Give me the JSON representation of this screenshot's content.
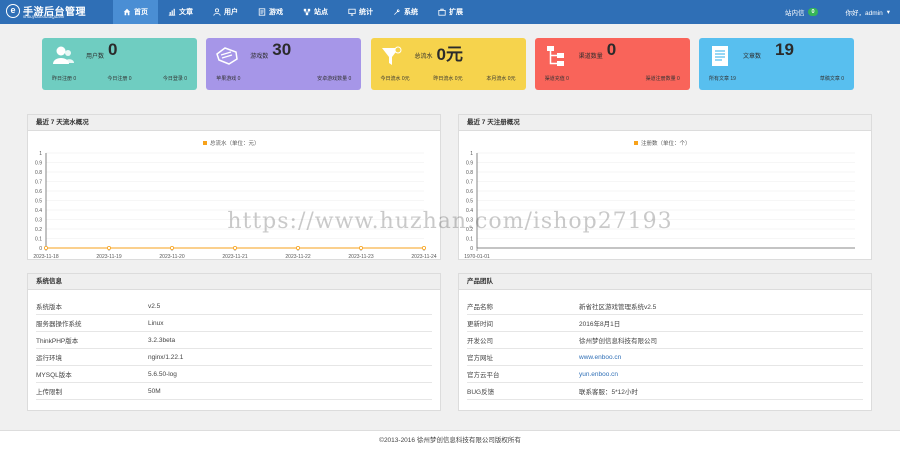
{
  "header": {
    "logo_mark": "e",
    "title": "手游后台管理",
    "subtitle": "shouyouhoutaiguanli",
    "nav": [
      {
        "label": "首页",
        "icon": "home-icon",
        "active": true
      },
      {
        "label": "文章",
        "icon": "bar-chart-icon"
      },
      {
        "label": "用户",
        "icon": "user-icon"
      },
      {
        "label": "游戏",
        "icon": "document-icon"
      },
      {
        "label": "站点",
        "icon": "sitemap-icon"
      },
      {
        "label": "统计",
        "icon": "monitor-icon"
      },
      {
        "label": "系统",
        "icon": "wrench-icon"
      },
      {
        "label": "扩展",
        "icon": "briefcase-icon"
      }
    ],
    "messages_label": "站内信",
    "messages_count": "0",
    "greeting": "你好，admin",
    "dropdown_caret": "▾"
  },
  "cards": [
    {
      "label": "用户数",
      "value": "0",
      "color": "#6fcdc1",
      "icon": "users-icon",
      "subs": [
        "昨日注册 0",
        "今日注册 0",
        "今日登录 0"
      ]
    },
    {
      "label": "游戏数",
      "value": "30",
      "color": "#a696e8",
      "icon": "gamepad-icon",
      "subs": [
        "苹果游戏 0",
        "安卓游戏数量 0"
      ]
    },
    {
      "label": "总流水",
      "value": "0元",
      "color": "#f6d34c",
      "icon": "funnel-icon",
      "subs": [
        "今日流水 0元",
        "昨日流水 0元",
        "本月流水 0元"
      ]
    },
    {
      "label": "渠道数量",
      "value": "0",
      "color": "#f9645a",
      "icon": "sitemap-icon",
      "subs": [
        "渠道充值 0",
        "渠道注册数量 0"
      ]
    },
    {
      "label": "文章数",
      "value": "19",
      "color": "#58bfef",
      "icon": "document-icon",
      "subs": [
        "所有文章 19",
        "草稿文章 0"
      ]
    }
  ],
  "panels": {
    "flow": {
      "title": "最近 7 天流水概况"
    },
    "register": {
      "title": "最近 7 天注册概况"
    },
    "sysinfo": {
      "title": "系统信息",
      "rows": [
        {
          "k": "系统版本",
          "v": "v2.5"
        },
        {
          "k": "服务器操作系统",
          "v": "Linux"
        },
        {
          "k": "ThinkPHP版本",
          "v": "3.2.3beta"
        },
        {
          "k": "运行环境",
          "v": "nginx/1.22.1"
        },
        {
          "k": "MYSQL版本",
          "v": "5.6.50-log"
        },
        {
          "k": "上传限制",
          "v": "50M"
        }
      ]
    },
    "team": {
      "title": "产品团队",
      "rows": [
        {
          "k": "产品名称",
          "v": "新省社区游戏管理系统v2.5"
        },
        {
          "k": "更新时间",
          "v": "2016年8月1日"
        },
        {
          "k": "开发公司",
          "v": "徐州梦创信息科技有限公司"
        },
        {
          "k": "官方网址",
          "v": "www.enboo.cn",
          "link": true
        },
        {
          "k": "官方云平台",
          "v": "yun.enboo.cn",
          "link": true
        },
        {
          "k": "BUG反馈",
          "v": "联系客服：5*12小时"
        }
      ]
    }
  },
  "chart_data": [
    {
      "type": "line",
      "title": "",
      "legend": [
        "总流水（单位：元）"
      ],
      "legend_position": "top-center",
      "grid": true,
      "x": [
        "2023-11-18",
        "2023-11-19",
        "2023-11-20",
        "2023-11-21",
        "2023-11-22",
        "2023-11-23",
        "2023-11-24"
      ],
      "series": [
        {
          "name": "总流水（单位：元）",
          "values": [
            0,
            0,
            0,
            0,
            0,
            0,
            0
          ]
        }
      ],
      "ylim": [
        0,
        1
      ],
      "yticks": [
        "0",
        "0.1",
        "0.2",
        "0.3",
        "0.4",
        "0.5",
        "0.6",
        "0.7",
        "0.8",
        "0.9",
        "1"
      ],
      "color": "#f7a21b"
    },
    {
      "type": "line",
      "title": "",
      "legend": [
        "注册数（单位：个）"
      ],
      "legend_position": "top-center",
      "grid": true,
      "x": [
        "1970-01-01"
      ],
      "series": [
        {
          "name": "注册数（单位：个）",
          "values": []
        }
      ],
      "ylim": [
        0,
        1
      ],
      "yticks": [
        "0",
        "0.1",
        "0.2",
        "0.3",
        "0.4",
        "0.5",
        "0.6",
        "0.7",
        "0.8",
        "0.9",
        "1"
      ],
      "color": "#f7a21b"
    }
  ],
  "footer": {
    "text": "©2013-2016 徐州梦创信息科技有限公司版权所有"
  },
  "watermark": "https://www.huzhan.com/ishop27193"
}
